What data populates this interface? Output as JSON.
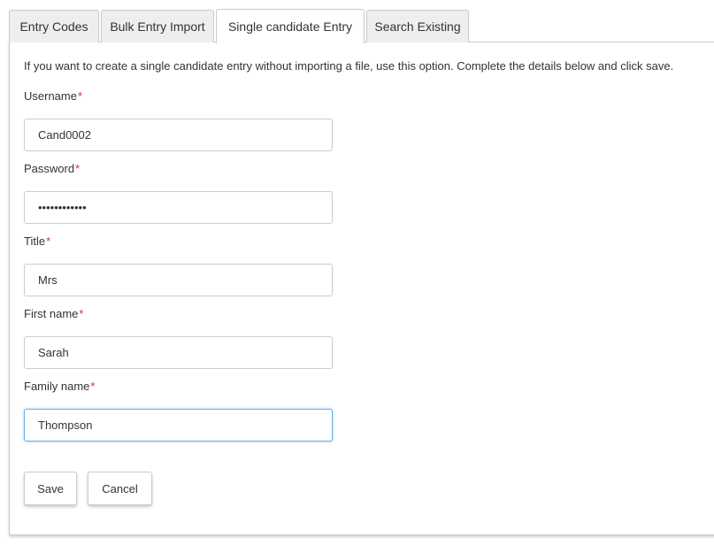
{
  "tabs": [
    {
      "label": "Entry Codes",
      "active": false
    },
    {
      "label": "Bulk Entry Import",
      "active": false
    },
    {
      "label": "Single candidate Entry",
      "active": true
    },
    {
      "label": "Search Existing",
      "active": false
    }
  ],
  "form": {
    "intro": "If you want to create a single candidate entry without importing a file, use this option. Complete the details below and click save.",
    "required_marker": "*",
    "username": {
      "label": "Username",
      "value": "Cand0002"
    },
    "password": {
      "label": "Password",
      "value": "............"
    },
    "title": {
      "label": "Title",
      "value": "Mrs"
    },
    "first_name": {
      "label": "First name",
      "value": "Sarah"
    },
    "family_name": {
      "label": "Family name",
      "value": "Thompson"
    }
  },
  "buttons": {
    "save": "Save",
    "cancel": "Cancel"
  },
  "colors": {
    "required": "#c0392b",
    "focus_border": "#66afe9",
    "tab_inactive_bg": "#eeeeee"
  }
}
